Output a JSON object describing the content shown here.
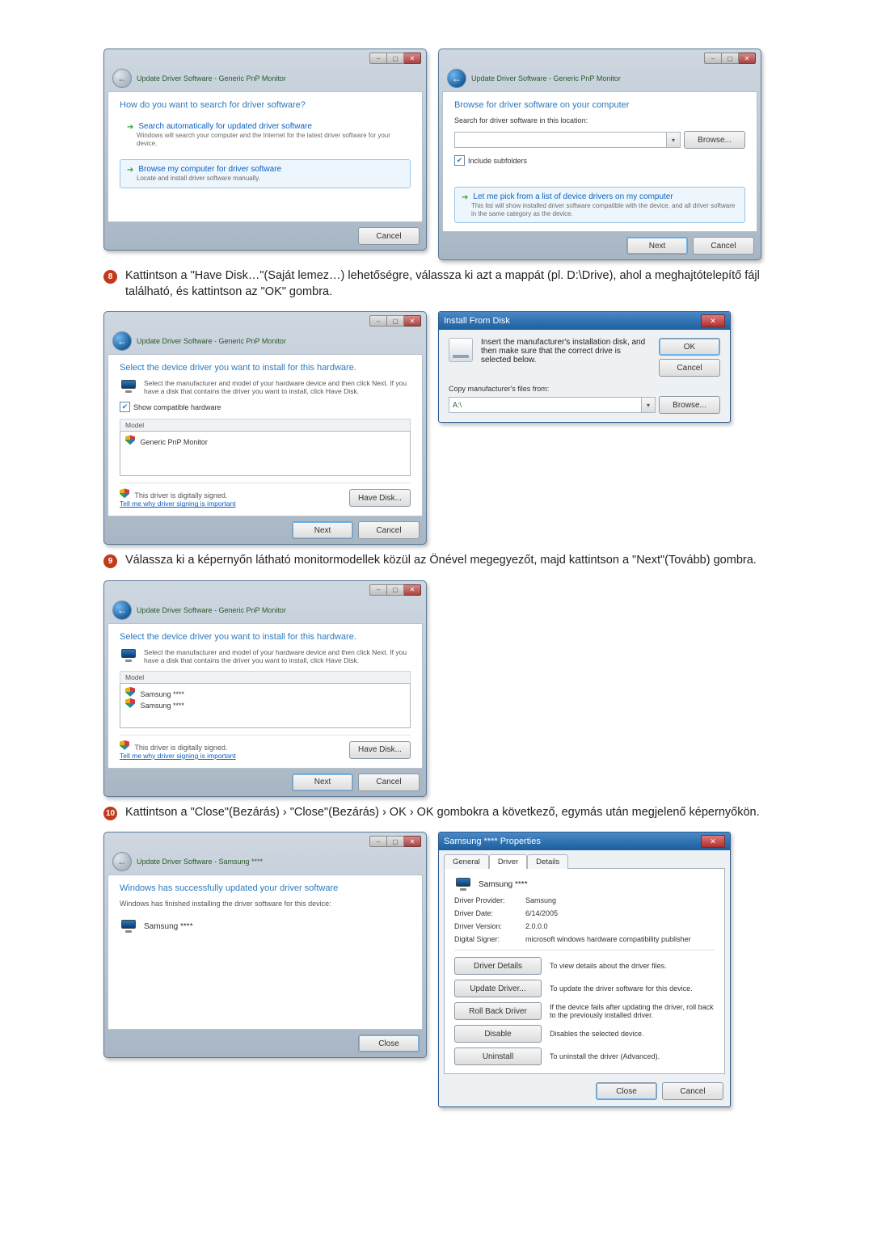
{
  "steps": {
    "s8": {
      "num": "8",
      "text": "Kattintson a \"Have Disk…\"(Saját lemez…) lehetőségre, válassza ki azt a mappát (pl. D:\\Drive), ahol a meghajtótelepítő fájl található, és kattintson az \"OK\" gombra."
    },
    "s9": {
      "num": "9",
      "text": "Válassza ki a képernyőn látható monitormodellek közül az Önével megegyezőt, majd kattintson a \"Next\"(Tovább) gombra."
    },
    "s10": {
      "num": "10",
      "text": "Kattintson a \"Close\"(Bezárás) › \"Close\"(Bezárás) › OK › OK gombokra a következő, egymás után megjelenő képernyőkön."
    }
  },
  "winA": {
    "breadcrumb": "Update Driver Software - Generic PnP Monitor",
    "heading": "How do you want to search for driver software?",
    "opt1_title": "Search automatically for updated driver software",
    "opt1_desc": "Windows will search your computer and the Internet for the latest driver software for your device.",
    "opt2_title": "Browse my computer for driver software",
    "opt2_desc": "Locate and install driver software manually.",
    "cancel": "Cancel"
  },
  "winB": {
    "breadcrumb": "Update Driver Software - Generic PnP Monitor",
    "heading": "Browse for driver software on your computer",
    "path_label": "Search for driver software in this location:",
    "path_value": "",
    "browse": "Browse...",
    "include": "Include subfolders",
    "opt_title": "Let me pick from a list of device drivers on my computer",
    "opt_desc": "This list will show installed driver software compatible with the device, and all driver software in the same category as the device.",
    "next": "Next",
    "cancel": "Cancel"
  },
  "winC": {
    "breadcrumb": "Update Driver Software - Generic PnP Monitor",
    "heading": "Select the device driver you want to install for this hardware.",
    "desc": "Select the manufacturer and model of your hardware device and then click Next. If you have a disk that contains the driver you want to install, click Have Disk.",
    "show_compat": "Show compatible hardware",
    "col_model": "Model",
    "row1": "Generic PnP Monitor",
    "signed": "This driver is digitally signed.",
    "why": "Tell me why driver signing is important",
    "have_disk": "Have Disk...",
    "next": "Next",
    "cancel": "Cancel"
  },
  "dlgDisk": {
    "title": "Install From Disk",
    "msg": "Insert the manufacturer's installation disk, and then make sure that the correct drive is selected below.",
    "ok": "OK",
    "cancel": "Cancel",
    "copy_label": "Copy manufacturer's files from:",
    "path_value": "A:\\",
    "browse": "Browse..."
  },
  "winD": {
    "breadcrumb": "Update Driver Software - Generic PnP Monitor",
    "heading": "Select the device driver you want to install for this hardware.",
    "desc": "Select the manufacturer and model of your hardware device and then click Next. If you have a disk that contains the driver you want to install, click Have Disk.",
    "col_model": "Model",
    "row1": "Samsung ****",
    "row2": "Samsung ****",
    "signed": "This driver is digitally signed.",
    "why": "Tell me why driver signing is important",
    "have_disk": "Have Disk...",
    "next": "Next",
    "cancel": "Cancel"
  },
  "winE": {
    "breadcrumb": "Update Driver Software - Samsung ****",
    "heading": "Windows has successfully updated your driver software",
    "desc": "Windows has finished installing the driver software for this device:",
    "device": "Samsung ****",
    "close": "Close"
  },
  "dlgProp": {
    "title": "Samsung **** Properties",
    "tabs": {
      "general": "General",
      "driver": "Driver",
      "details": "Details"
    },
    "device": "Samsung ****",
    "kv": {
      "provider_k": "Driver Provider:",
      "provider_v": "Samsung",
      "date_k": "Driver Date:",
      "date_v": "6/14/2005",
      "version_k": "Driver Version:",
      "version_v": "2.0.0.0",
      "signer_k": "Digital Signer:",
      "signer_v": "microsoft windows hardware compatibility publisher"
    },
    "actions": {
      "details_btn": "Driver Details",
      "details_txt": "To view details about the driver files.",
      "update_btn": "Update Driver...",
      "update_txt": "To update the driver software for this device.",
      "rollback_btn": "Roll Back Driver",
      "rollback_txt": "If the device fails after updating the driver, roll back to the previously installed driver.",
      "disable_btn": "Disable",
      "disable_txt": "Disables the selected device.",
      "uninstall_btn": "Uninstall",
      "uninstall_txt": "To uninstall the driver (Advanced)."
    },
    "close": "Close",
    "cancel": "Cancel"
  }
}
